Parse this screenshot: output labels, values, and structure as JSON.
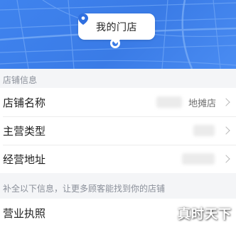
{
  "map": {
    "store_label": "我的门店",
    "pin_icon": "location-pin-icon",
    "background": "#3f83ee"
  },
  "store_info": {
    "section_title": "店铺信息",
    "rows": [
      {
        "label": "店铺名称",
        "value": "地摊店"
      },
      {
        "label": "主营类型",
        "value": ""
      },
      {
        "label": "经营地址",
        "value": ""
      }
    ]
  },
  "extra_info": {
    "section_title": "补全以下信息，让更多顾客能找到你的店铺",
    "rows": [
      {
        "label": "营业执照"
      }
    ]
  },
  "watermark": "真时天下"
}
